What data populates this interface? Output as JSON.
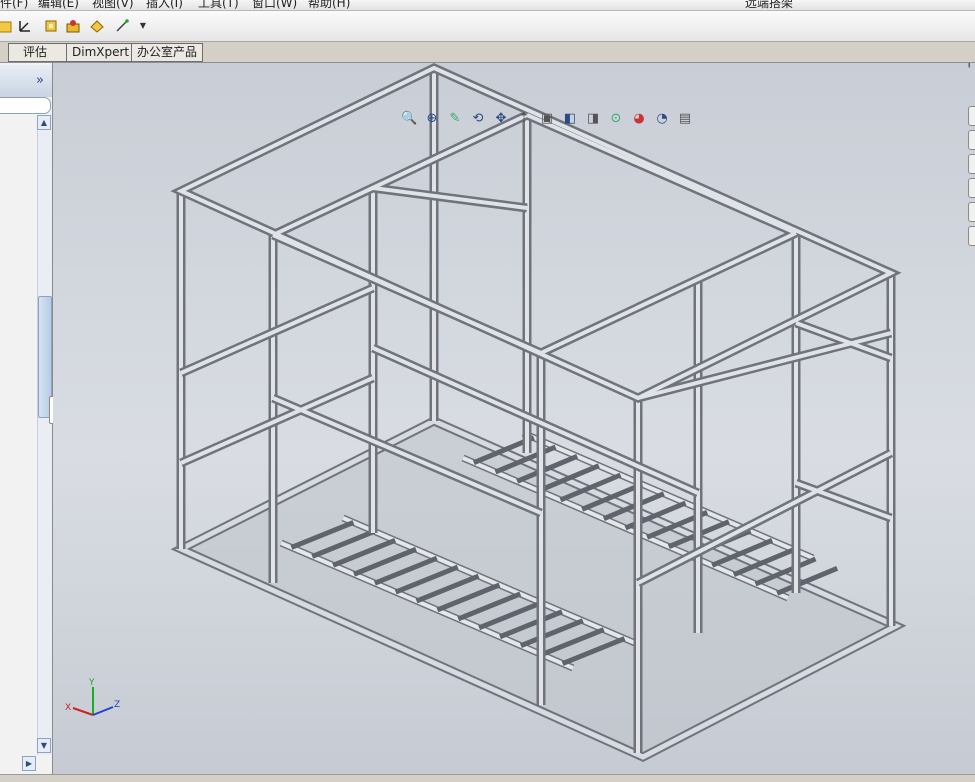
{
  "menu": {
    "items": [
      "件(F)",
      "编辑(E)",
      "视图(V)",
      "插入(I)",
      "工具(T)",
      "窗口(W)",
      "帮助(H)"
    ],
    "window_title": "远端搭架"
  },
  "tabs": [
    "评估",
    "DimXpert",
    "办公室产品"
  ],
  "panel": {
    "expand_label": "»"
  },
  "toolbar_icons": [
    "folder-icon",
    "sketch-icon",
    "part-icon",
    "assembly-icon",
    "shaded-icon",
    "smart-dimension-icon"
  ],
  "view_tools": [
    "zoom-to-fit-icon",
    "zoom-area-icon",
    "previous-view-icon",
    "rotate-icon",
    "pan-icon",
    "orient-icon",
    "section-view-icon",
    "view-orientation-icon",
    "display-style-icon",
    "hide-show-icon",
    "appearance-icon",
    "scene-icon",
    "view-settings-icon"
  ],
  "triad": {
    "x": "X",
    "y": "Y",
    "z": "Z"
  },
  "colors": {
    "frame": "#b9bcc4",
    "frame_dark": "#6f737c",
    "accent": "#2b4a86",
    "axis_x": "#cc2222",
    "axis_y": "#22aa22",
    "axis_z": "#2244cc"
  }
}
